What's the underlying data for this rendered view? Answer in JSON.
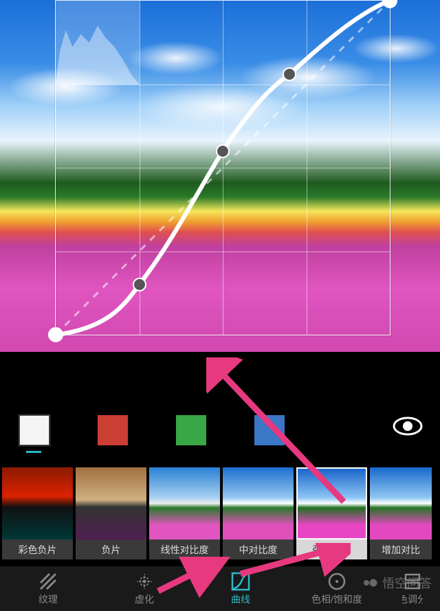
{
  "curve": {
    "points": [
      {
        "x": 0.0,
        "y": 1.0
      },
      {
        "x": 0.25,
        "y": 0.85
      },
      {
        "x": 0.5,
        "y": 0.45
      },
      {
        "x": 0.7,
        "y": 0.22
      },
      {
        "x": 1.0,
        "y": 0.0
      }
    ]
  },
  "channels": {
    "items": [
      "rgb",
      "red",
      "green",
      "blue"
    ],
    "selected": "rgb"
  },
  "presets": {
    "items": [
      {
        "id": "color-negative",
        "label": "彩色负片"
      },
      {
        "id": "negative",
        "label": "负片"
      },
      {
        "id": "linear-contrast",
        "label": "线性对比度"
      },
      {
        "id": "medium-contrast",
        "label": "中对比度"
      },
      {
        "id": "strong-contrast",
        "label": "强对比度"
      },
      {
        "id": "increase-contrast",
        "label": "增加对比"
      }
    ],
    "selected": "strong-contrast"
  },
  "toolbar": {
    "items": [
      {
        "id": "texture",
        "label": "纹理"
      },
      {
        "id": "blur",
        "label": "虚化"
      },
      {
        "id": "curves",
        "label": "曲线"
      },
      {
        "id": "hsl",
        "label": "色相/饱和度"
      },
      {
        "id": "split-tone",
        "label": "色调分"
      }
    ],
    "active": "curves"
  },
  "watermark": {
    "text": "悟空问答"
  }
}
